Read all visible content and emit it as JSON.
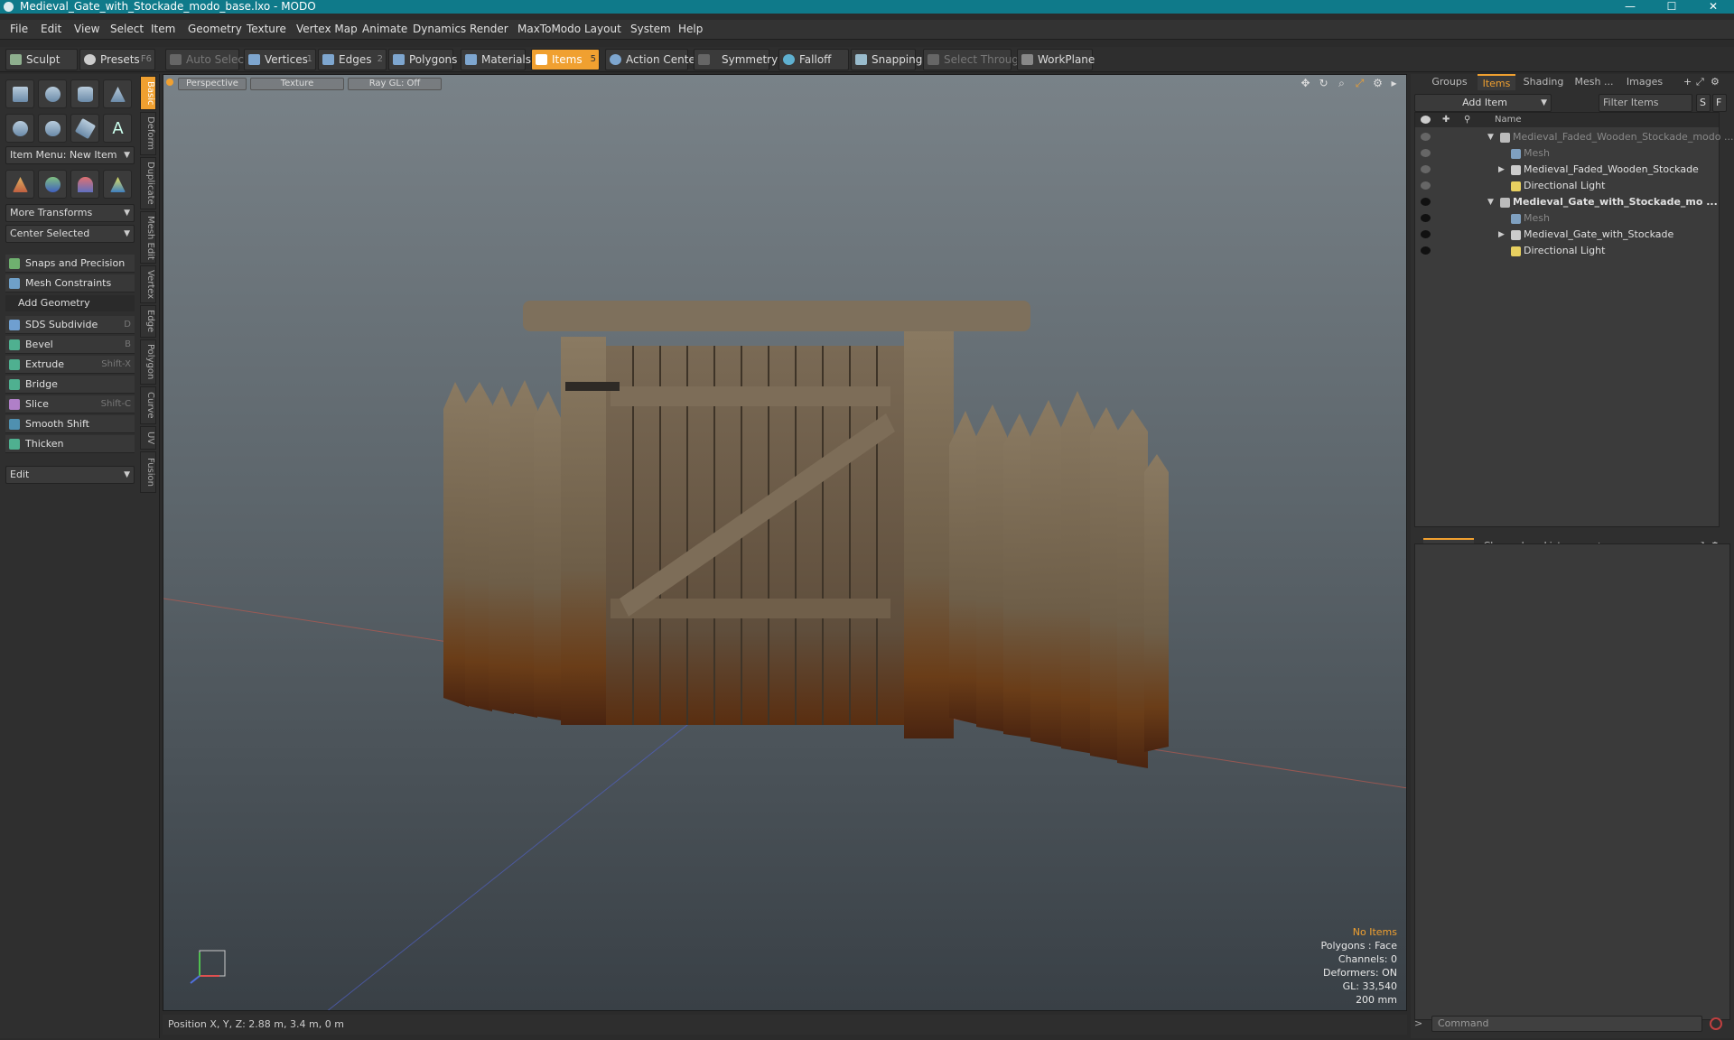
{
  "window": {
    "title": "Medieval_Gate_with_Stockade_modo_base.lxo - MODO",
    "minimize": "—",
    "maximize": "☐",
    "close": "✕"
  },
  "menu": [
    "File",
    "Edit",
    "View",
    "Select",
    "Item",
    "Geometry",
    "Texture",
    "Vertex Map",
    "Animate",
    "Dynamics",
    "Render",
    "MaxToModo",
    "Layout",
    "System",
    "Help"
  ],
  "toolbar": {
    "sculpt": "Sculpt",
    "presets": "Presets",
    "presets_key": "F6",
    "auto_select": "Auto Select",
    "vertices": "Vertices",
    "vertices_num": "1",
    "edges": "Edges",
    "edges_num": "2",
    "polygons": "Polygons",
    "materials": "Materials",
    "items": "Items",
    "items_num": "5",
    "action_center": "Action Center",
    "symmetry": "Symmetry",
    "falloff": "Falloff",
    "snapping": "Snapping",
    "select_through": "Select Through",
    "workplane": "WorkPlane"
  },
  "left": {
    "item_menu": "Item Menu: New Item",
    "more_transforms": "More Transforms",
    "center_selected": "Center Selected",
    "snaps": "Snaps and Precision",
    "mesh_constraints": "Mesh Constraints",
    "add_geometry": "Add Geometry",
    "tools": [
      {
        "label": "SDS Subdivide",
        "key": "D"
      },
      {
        "label": "Bevel",
        "key": "B"
      },
      {
        "label": "Extrude",
        "key": "Shift-X"
      },
      {
        "label": "Bridge",
        "key": ""
      },
      {
        "label": "Slice",
        "key": "Shift-C"
      },
      {
        "label": "Smooth Shift",
        "key": ""
      },
      {
        "label": "Thicken",
        "key": ""
      }
    ],
    "edit": "Edit"
  },
  "vtabs": [
    "Basic",
    "Deform",
    "Duplicate",
    "Mesh Edit",
    "Vertex",
    "Edge",
    "Polygon",
    "Curve",
    "UV",
    "Fusion"
  ],
  "viewport": {
    "perspective": "Perspective",
    "texture": "Texture",
    "raygl": "Ray GL: Off",
    "info": {
      "no_items": "No Items",
      "polygons": "Polygons : Face",
      "channels": "Channels: 0",
      "deformers": "Deformers: ON",
      "gl": "GL: 33,540",
      "scale": "200 mm"
    }
  },
  "status": {
    "position": "Position X, Y, Z:  2.88 m, 3.4 m, 0 m"
  },
  "right": {
    "tabs": [
      "Groups",
      "Items",
      "Shading",
      "Mesh ...",
      "Images"
    ],
    "add_item": "Add Item",
    "filter_items": "Filter Items",
    "filter_s": "S",
    "filter_f": "F",
    "col_name": "Name",
    "tree": [
      {
        "label": "Medieval_Faded_Wooden_Stockade_modo ...",
        "indent": 0,
        "exp": "▼",
        "dim": true,
        "bold": false,
        "eye": "dim",
        "icon": "scene"
      },
      {
        "label": "Mesh",
        "indent": 1,
        "exp": "",
        "dim": true,
        "bold": false,
        "eye": "dim",
        "icon": "mesh"
      },
      {
        "label": "Medieval_Faded_Wooden_Stockade",
        "indent": 1,
        "exp": "▶",
        "dim": false,
        "bold": false,
        "eye": "dim",
        "icon": "group"
      },
      {
        "label": "Directional Light",
        "indent": 1,
        "exp": "",
        "dim": false,
        "bold": false,
        "eye": "dim",
        "icon": "light"
      },
      {
        "label": "Medieval_Gate_with_Stockade_mo ...",
        "indent": 0,
        "exp": "▼",
        "dim": false,
        "bold": true,
        "eye": "on",
        "icon": "scene"
      },
      {
        "label": "Mesh",
        "indent": 1,
        "exp": "",
        "dim": true,
        "bold": false,
        "eye": "on",
        "icon": "mesh"
      },
      {
        "label": "Medieval_Gate_with_Stockade",
        "indent": 1,
        "exp": "▶",
        "dim": false,
        "bold": false,
        "eye": "on",
        "icon": "group"
      },
      {
        "label": "Directional Light",
        "indent": 1,
        "exp": "",
        "dim": false,
        "bold": false,
        "eye": "on",
        "icon": "light"
      }
    ],
    "props_tabs": [
      "Properties",
      "Channels",
      "Lists"
    ],
    "command_placeholder": "Command"
  },
  "colors": {
    "accent": "#f0a030",
    "title_bar": "#0f7a8a"
  }
}
